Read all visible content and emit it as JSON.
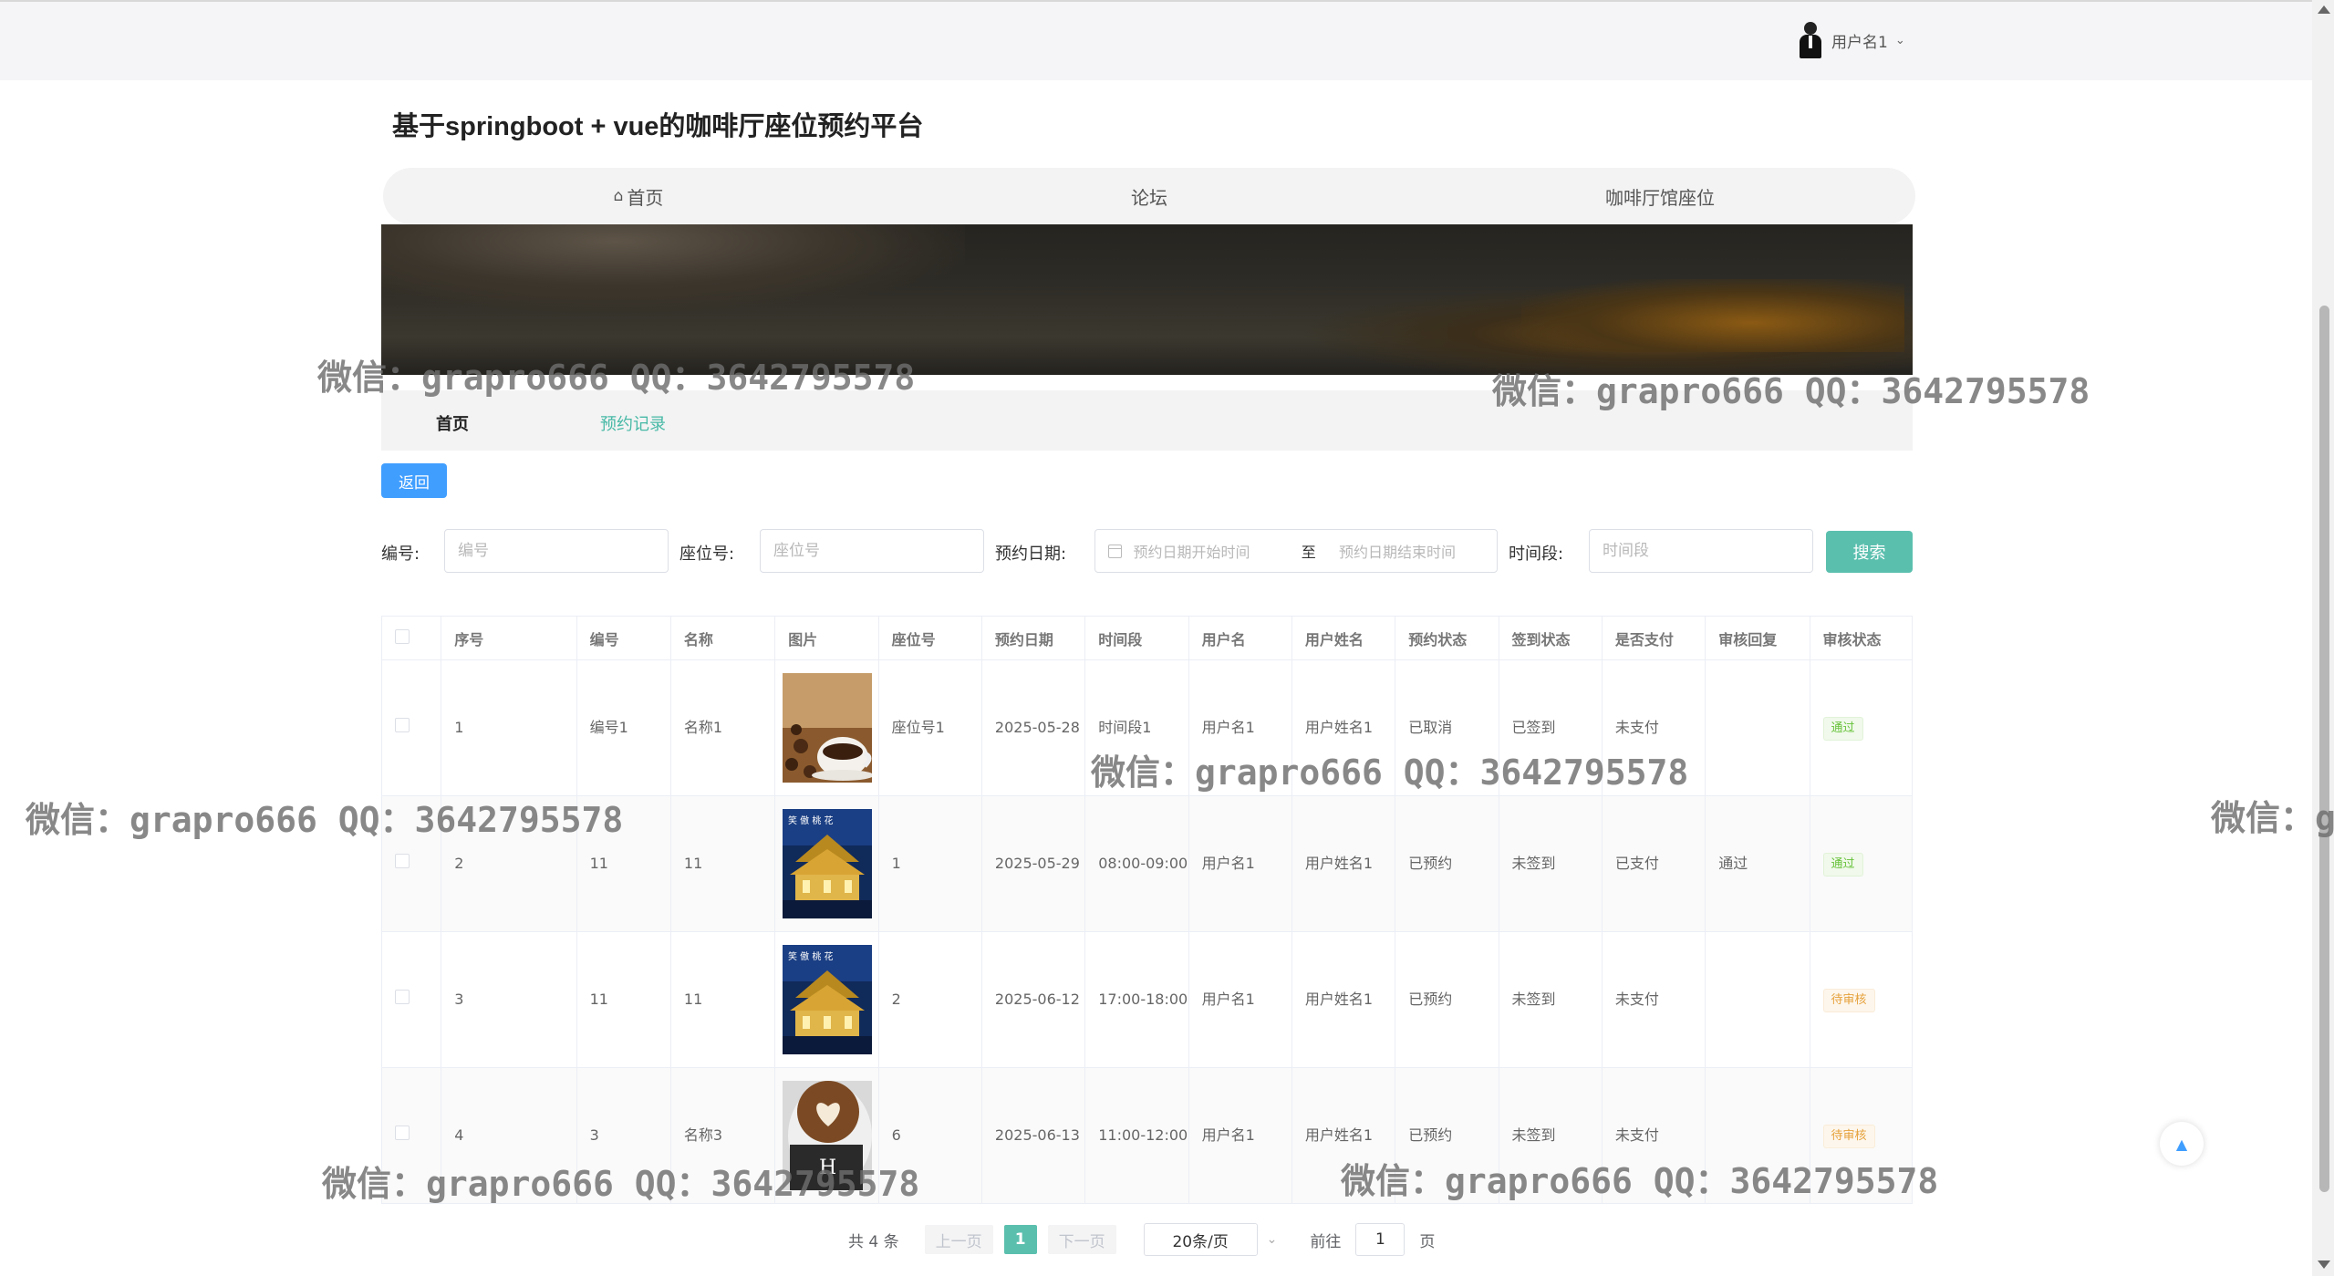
{
  "header": {
    "username": "用户名1"
  },
  "site_title": "基于springboot + vue的咖啡厅座位预约平台",
  "nav": {
    "items": [
      "首页",
      "论坛",
      "咖啡厅馆座位"
    ]
  },
  "breadcrumb": {
    "home": "首页",
    "current": "预约记录"
  },
  "back_label": "返回",
  "search": {
    "fields": [
      {
        "label": "编号:",
        "placeholder": "编号"
      },
      {
        "label": "座位号:",
        "placeholder": "座位号"
      },
      {
        "label": "预约日期:",
        "placeholder": ""
      },
      {
        "label": "时间段:",
        "placeholder": "时间段"
      }
    ],
    "date_start_placeholder": "预约日期开始时间",
    "date_sep": "至",
    "date_end_placeholder": "预约日期结束时间",
    "button": "搜索"
  },
  "table": {
    "headers": [
      "序号",
      "编号",
      "名称",
      "图片",
      "座位号",
      "预约日期",
      "时间段",
      "用户名",
      "用户姓名",
      "预约状态",
      "签到状态",
      "是否支付",
      "审核回复",
      "审核状态"
    ],
    "rows": [
      {
        "seq": "1",
        "code": "编号1",
        "name": "名称1",
        "image": "coffee-beans-cup",
        "seat": "座位号1",
        "date": "2025-05-28",
        "slot": "时间段1",
        "user": "用户名1",
        "real_name": "用户姓名1",
        "status": "已取消",
        "checkin": "已签到",
        "paid": "未支付",
        "reply": "",
        "audit": "通过",
        "audit_type": "pass"
      },
      {
        "seq": "2",
        "code": "11",
        "name": "11",
        "image": "night-pavilion",
        "seat": "1",
        "date": "2025-05-29",
        "slot": "08:00-09:00",
        "user": "用户名1",
        "real_name": "用户姓名1",
        "status": "已预约",
        "checkin": "未签到",
        "paid": "已支付",
        "reply": "通过",
        "audit": "通过",
        "audit_type": "pass"
      },
      {
        "seq": "3",
        "code": "11",
        "name": "11",
        "image": "night-pavilion",
        "seat": "2",
        "date": "2025-06-12",
        "slot": "17:00-18:00",
        "user": "用户名1",
        "real_name": "用户姓名1",
        "status": "已预约",
        "checkin": "未签到",
        "paid": "未支付",
        "reply": "",
        "audit": "待审核",
        "audit_type": "pending"
      },
      {
        "seq": "4",
        "code": "3",
        "name": "名称3",
        "image": "latte-art",
        "seat": "6",
        "date": "2025-06-13",
        "slot": "11:00-12:00",
        "user": "用户名1",
        "real_name": "用户姓名1",
        "status": "已预约",
        "checkin": "未签到",
        "paid": "未支付",
        "reply": "",
        "audit": "待审核",
        "audit_type": "pending"
      }
    ]
  },
  "pagination": {
    "total": "共 4 条",
    "prev": "上一页",
    "page": "1",
    "next": "下一页",
    "page_size": "20条/页",
    "goto": "前往",
    "goto_value": "1",
    "page_unit": "页"
  },
  "watermark": "微信：grapro666 QQ：3642795578",
  "watermark_cut": "微信：g",
  "colors": {
    "primary": "#409eff",
    "accent": "#5bbfae",
    "pass": "#67c23a",
    "pending": "#e6a23c"
  }
}
